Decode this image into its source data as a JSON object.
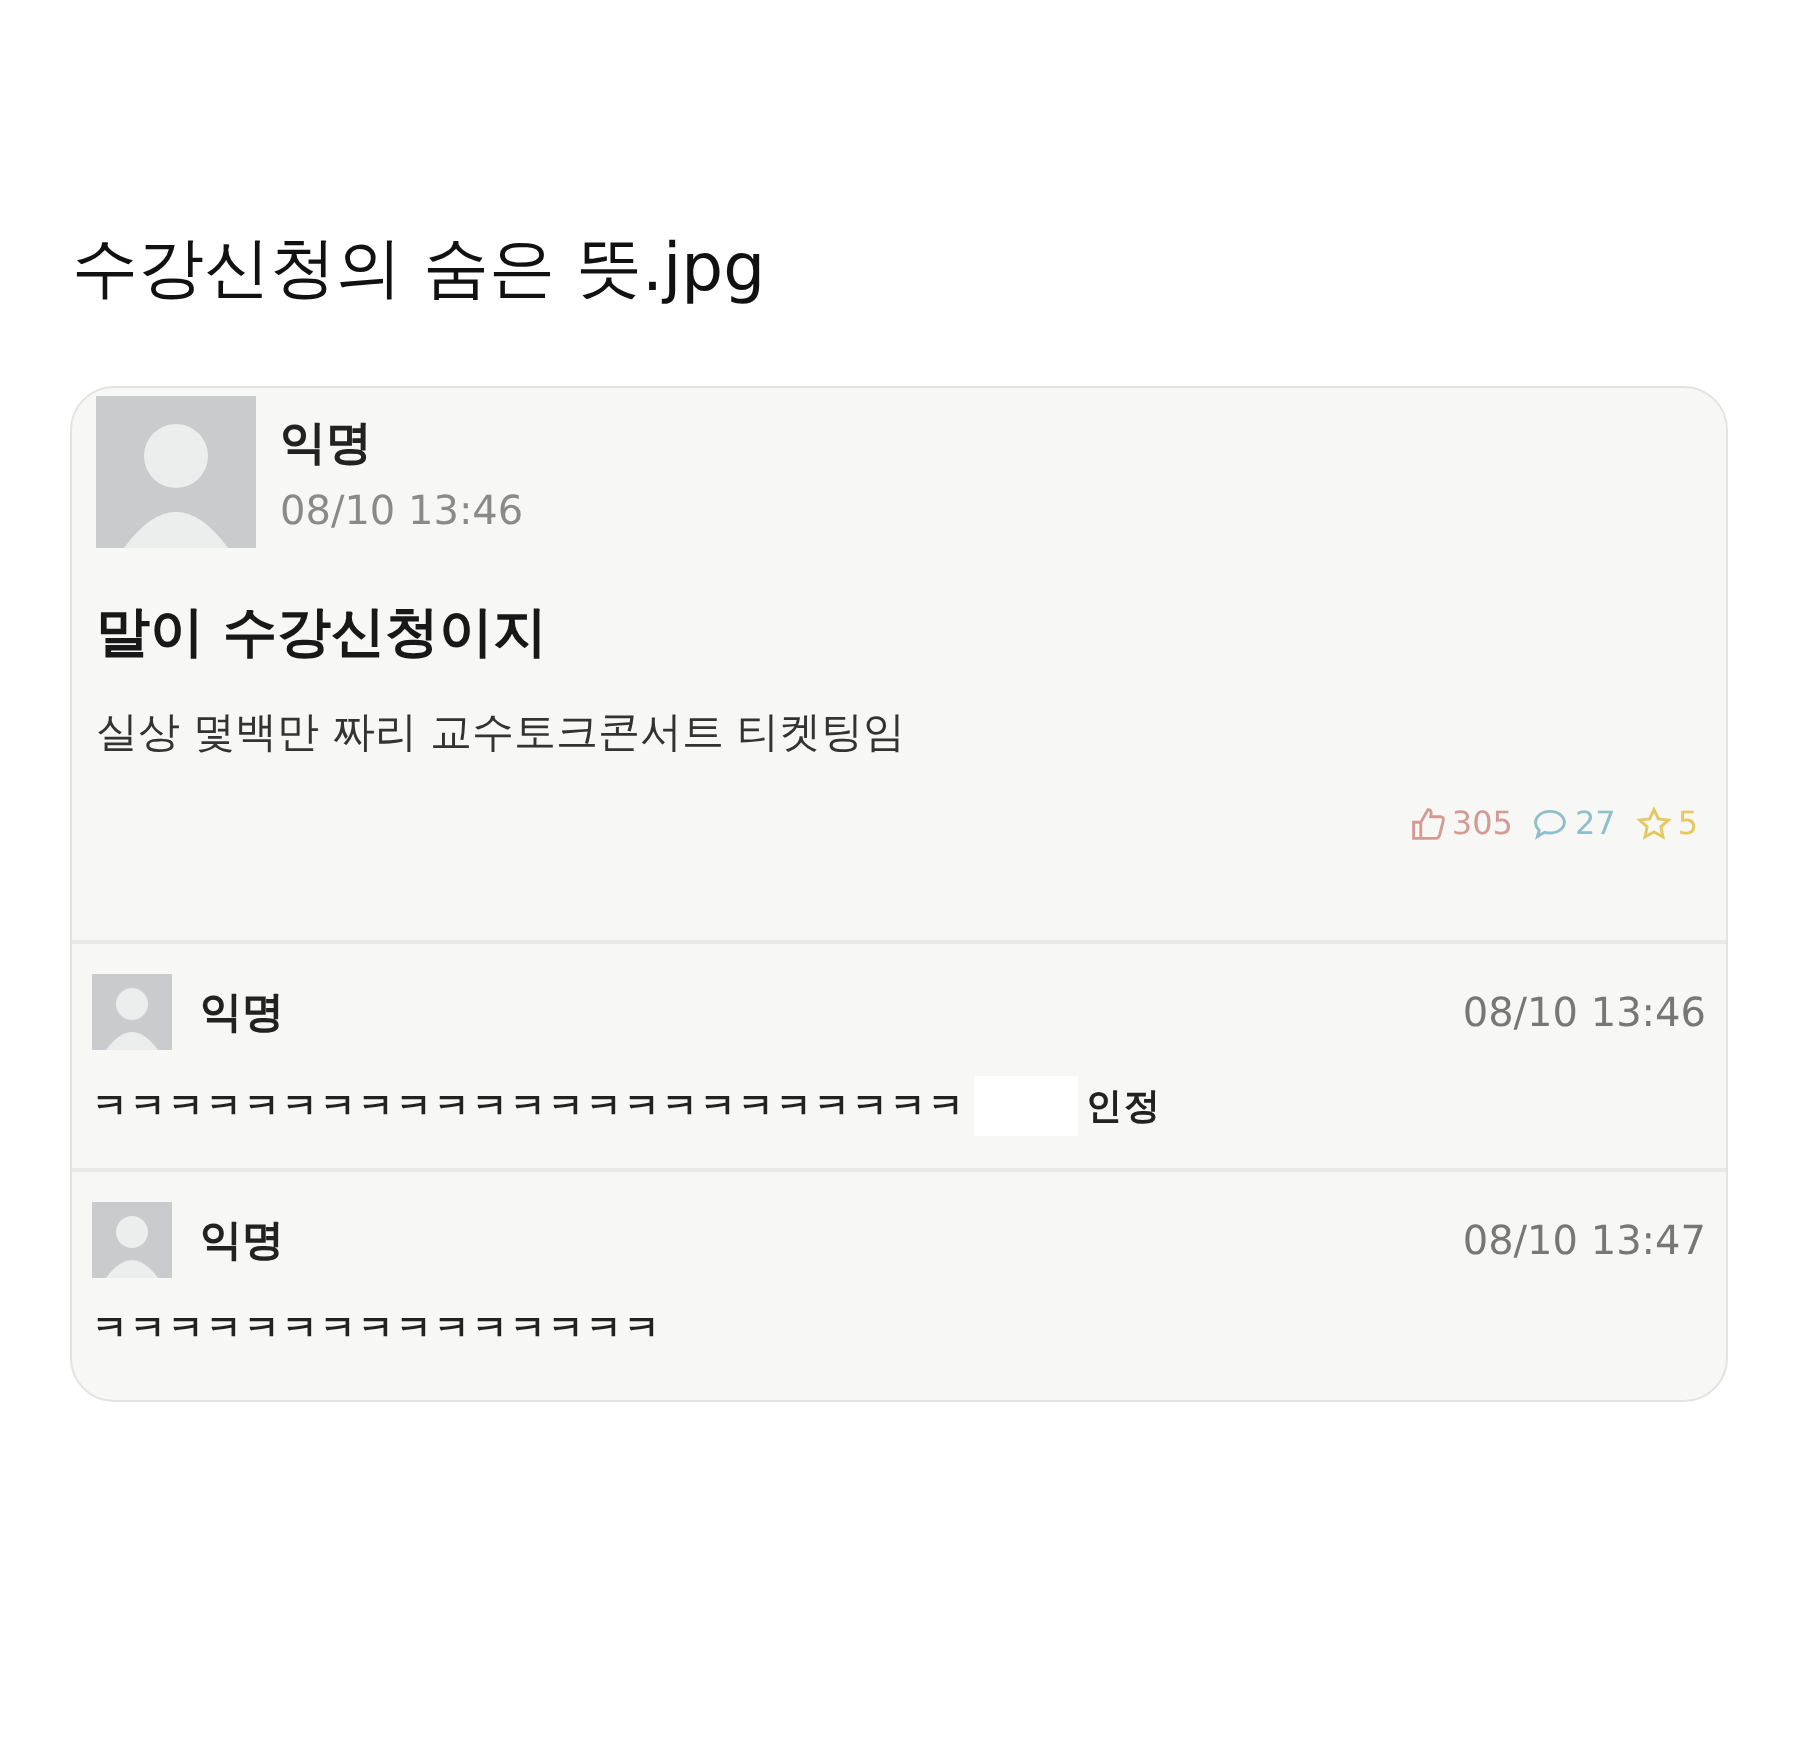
{
  "caption": "수강신청의 숨은 뜻.jpg",
  "post": {
    "author": "익명",
    "time": "08/10 13:46",
    "title": "말이 수강신청이지",
    "body": "실상 몇백만 짜리 교수토크콘서트 티켓팅임",
    "counters": [
      {
        "kind": "like",
        "value": "305",
        "color": "#d49a94"
      },
      {
        "kind": "comment",
        "value": "27",
        "color": "#8fbfcc"
      },
      {
        "kind": "scrap",
        "value": "5",
        "color": "#e3c95e"
      }
    ]
  },
  "comments": [
    {
      "author": "익명",
      "time": "08/10 13:46",
      "parts": [
        "ㅋㅋㅋㅋㅋㅋㅋㅋㅋㅋㅋㅋㅋㅋㅋㅋㅋㅋㅋㅋㅋㅋㅋ",
        "인정"
      ]
    },
    {
      "author": "익명",
      "time": "08/10 13:47",
      "parts": [
        "ㅋㅋㅋㅋㅋㅋㅋㅋㅋㅋㅋㅋㅋㅋㅋ"
      ]
    }
  ]
}
